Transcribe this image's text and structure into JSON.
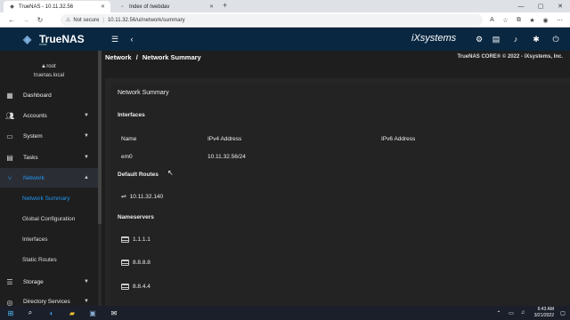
{
  "browser": {
    "tabs": [
      {
        "title": "TrueNAS - 10.11.32.56"
      },
      {
        "title": "Index of /webdav"
      }
    ],
    "new_tab": "+",
    "security_label": "Not secure",
    "url": "10.11.32.56/ui/network/summary",
    "window_controls": [
      "—",
      "▢",
      "✕"
    ]
  },
  "header": {
    "brand": "TrueNAS",
    "brand_sub": "CORE",
    "vendor": "iXsystems"
  },
  "sidebar": {
    "user": {
      "name": "root",
      "host": "truenas.local"
    },
    "items": [
      {
        "label": "Dashboard",
        "icon": "dashboard-icon"
      },
      {
        "label": "Accounts",
        "icon": "accounts-icon"
      },
      {
        "label": "System",
        "icon": "system-icon"
      },
      {
        "label": "Tasks",
        "icon": "tasks-icon"
      },
      {
        "label": "Network",
        "icon": "network-icon"
      }
    ],
    "network_subitems": [
      {
        "label": "Network Summary"
      },
      {
        "label": "Global Configuration"
      },
      {
        "label": "Interfaces"
      },
      {
        "label": "Static Routes"
      }
    ],
    "more_items": [
      {
        "label": "Storage"
      },
      {
        "label": "Directory Services"
      }
    ]
  },
  "breadcrumb": {
    "parent": "Network",
    "separator": "/",
    "current": "Network Summary"
  },
  "copyright": "TrueNAS CORE® © 2022 - iXsystems, Inc.",
  "summary": {
    "title": "Network Summary",
    "interfaces_heading": "Interfaces",
    "columns": [
      "Name",
      "IPv4 Address",
      "IPv6 Address"
    ],
    "rows": [
      {
        "name": "em0",
        "ipv4": "10.11.32.56/24",
        "ipv6": ""
      }
    ],
    "routes_heading": "Default Routes",
    "routes": [
      "10.11.32.140"
    ],
    "ns_heading": "Nameservers",
    "nameservers": [
      "1.1.1.1",
      "8.8.8.8",
      "8.8.4.4"
    ]
  },
  "taskbar": {
    "time": "6:43 AM",
    "date": "3/21/2022"
  },
  "colors": {
    "header_bg": "#0a2741",
    "accent": "#2196f3",
    "sidebar_bg": "#1e1e1e"
  }
}
